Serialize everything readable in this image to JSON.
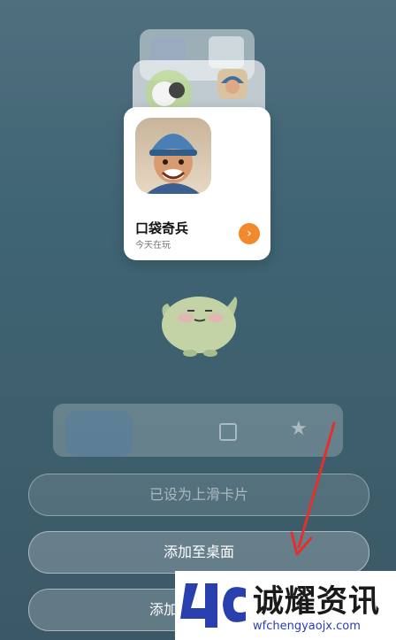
{
  "featured_card": {
    "title": "口袋奇兵",
    "subtitle": "今天在玩",
    "go_icon": "›"
  },
  "buttons": {
    "set_slide_card": "已设为上滑卡片",
    "add_to_desktop": "添加至桌面",
    "third_partial": "添加"
  },
  "watermark": {
    "name": "诚耀资讯",
    "url": "wfchengyaojx.com"
  },
  "colors": {
    "accent_orange": "#f08a2c",
    "annotation_red": "#e2302c",
    "watermark_blue": "#2a3fae"
  }
}
